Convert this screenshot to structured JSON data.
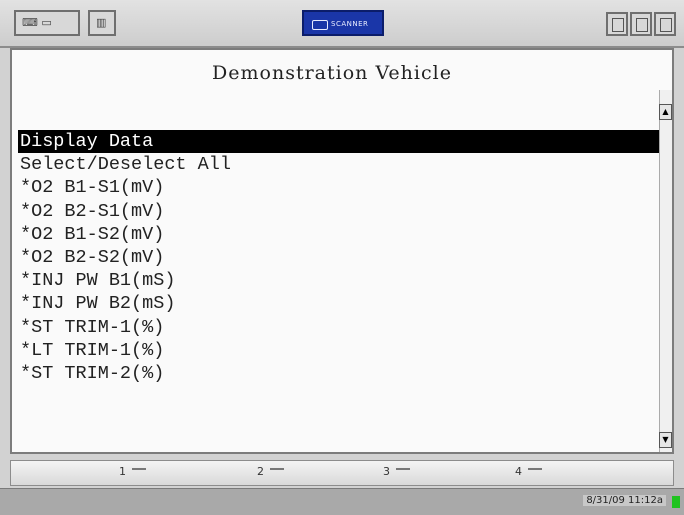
{
  "toolbar": {
    "left_button_icon": "keyboard-icon",
    "second_button_icon": "screen-icon",
    "brand_label": "SCANNER",
    "right_icons": [
      "window-icon",
      "print-icon",
      "save-icon"
    ]
  },
  "screen": {
    "title": "Demonstration Vehicle",
    "items": [
      {
        "label": "Display Data",
        "selected": true
      },
      {
        "label": "Select/Deselect All"
      },
      {
        "label": "*O2 B1-S1(mV)"
      },
      {
        "label": "*O2 B2-S1(mV)"
      },
      {
        "label": "*O2 B1-S2(mV)"
      },
      {
        "label": "*O2 B2-S2(mV)"
      },
      {
        "label": "*INJ PW B1(mS)"
      },
      {
        "label": "*INJ PW B2(mS)"
      },
      {
        "label": "*ST TRIM-1(%)"
      },
      {
        "label": "*LT TRIM-1(%)"
      },
      {
        "label": "*ST TRIM-2(%)"
      }
    ]
  },
  "function_keys": [
    "1",
    "2",
    "3",
    "4"
  ],
  "status": {
    "text": "8/31/09  11:12a"
  },
  "colors": {
    "brand": "#1a36a8",
    "highlight": "#000000",
    "status_led": "#1fc31f"
  }
}
